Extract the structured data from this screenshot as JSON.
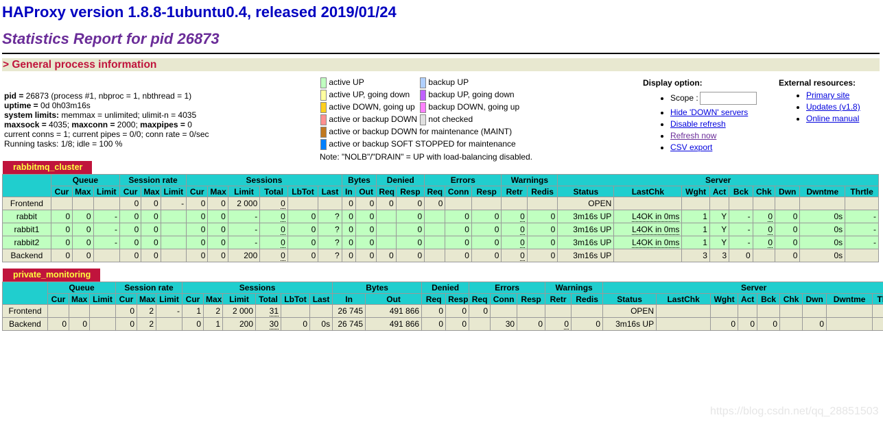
{
  "title": "HAProxy version 1.8.8-1ubuntu0.4, released 2019/01/24",
  "subtitle": "Statistics Report for pid 26873",
  "general_header": "> General process information",
  "process_info": [
    {
      "label": "pid = ",
      "value": "26873 (process #1, nbproc = 1, nbthread = 1)"
    },
    {
      "label": "uptime = ",
      "value": "0d 0h03m16s"
    },
    {
      "label": "system limits:",
      "value": " memmax = unlimited; ulimit-n = 4035"
    },
    {
      "label": "maxsock = ",
      "value": "4035; ",
      "label2": "maxconn = ",
      "value2": "2000; ",
      "label3": "maxpipes = ",
      "value3": "0"
    },
    {
      "label": "",
      "value": "current conns = 1; current pipes = 0/0; conn rate = 0/sec"
    },
    {
      "label": "",
      "value": "Running tasks: 1/8; idle = 100 %"
    }
  ],
  "legend": {
    "rows": [
      [
        {
          "color": "#c0ffc0",
          "text": "active UP"
        },
        {
          "color": "#b0d0ff",
          "text": "backup UP"
        }
      ],
      [
        {
          "color": "#ffffa0",
          "text": "active UP, going down"
        },
        {
          "color": "#c060ff",
          "text": "backup UP, going down"
        }
      ],
      [
        {
          "color": "#ffd020",
          "text": "active DOWN, going up"
        },
        {
          "color": "#ff80ff",
          "text": "backup DOWN, going up"
        }
      ],
      [
        {
          "color": "#ff9090",
          "text": "active or backup DOWN"
        },
        {
          "color": "#e0e0e0",
          "text": "not checked"
        }
      ],
      [
        {
          "color": "#c07820",
          "text": "active or backup DOWN for maintenance (MAINT)"
        }
      ],
      [
        {
          "color": "#0080ff",
          "text": "active or backup SOFT STOPPED for maintenance"
        }
      ]
    ],
    "note": "Note: \"NOLB\"/\"DRAIN\" = UP with load-balancing disabled."
  },
  "display": {
    "title": "Display option:",
    "scope_label": "Scope :",
    "links": [
      "Hide 'DOWN' servers",
      "Disable refresh",
      "Refresh now",
      "CSV export"
    ]
  },
  "external": {
    "title": "External resources:",
    "links": [
      "Primary site",
      "Updates (v1.8)",
      "Online manual"
    ]
  },
  "proxies": [
    {
      "name": "rabbitmq_cluster",
      "groups": [
        "Queue",
        "Session rate",
        "Sessions",
        "Bytes",
        "Denied",
        "Errors",
        "Warnings",
        "Server"
      ],
      "columns": [
        "Cur",
        "Max",
        "Limit",
        "Cur",
        "Max",
        "Limit",
        "Cur",
        "Max",
        "Limit",
        "Total",
        "LbTot",
        "Last",
        "In",
        "Out",
        "Req",
        "Resp",
        "Req",
        "Conn",
        "Resp",
        "Retr",
        "Redis",
        "Status",
        "LastChk",
        "Wght",
        "Act",
        "Bck",
        "Chk",
        "Dwn",
        "Dwntme",
        "Thrtle"
      ],
      "rows": [
        {
          "kind": "fe",
          "name": "Frontend",
          "cells": [
            "",
            "",
            "",
            "0",
            "0",
            "-",
            "0",
            "0",
            "2 000",
            "0",
            "",
            "",
            "0",
            "0",
            "0",
            "0",
            "0",
            "",
            "",
            "",
            "",
            "OPEN",
            "",
            "",
            "",
            "",
            "",
            "",
            "",
            ""
          ]
        },
        {
          "kind": "sv",
          "name": "rabbit",
          "cells": [
            "0",
            "0",
            "-",
            "0",
            "0",
            "",
            "0",
            "0",
            "-",
            "0",
            "0",
            "?",
            "0",
            "0",
            "",
            "0",
            "",
            "0",
            "0",
            "0",
            "0",
            "3m16s UP",
            "L4OK in 0ms",
            "1",
            "Y",
            "-",
            "0",
            "0",
            "0s",
            "-"
          ]
        },
        {
          "kind": "sv",
          "name": "rabbit1",
          "cells": [
            "0",
            "0",
            "-",
            "0",
            "0",
            "",
            "0",
            "0",
            "-",
            "0",
            "0",
            "?",
            "0",
            "0",
            "",
            "0",
            "",
            "0",
            "0",
            "0",
            "0",
            "3m16s UP",
            "L4OK in 0ms",
            "1",
            "Y",
            "-",
            "0",
            "0",
            "0s",
            "-"
          ]
        },
        {
          "kind": "sv",
          "name": "rabbit2",
          "cells": [
            "0",
            "0",
            "-",
            "0",
            "0",
            "",
            "0",
            "0",
            "-",
            "0",
            "0",
            "?",
            "0",
            "0",
            "",
            "0",
            "",
            "0",
            "0",
            "0",
            "0",
            "3m16s UP",
            "L4OK in 0ms",
            "1",
            "Y",
            "-",
            "0",
            "0",
            "0s",
            "-"
          ]
        },
        {
          "kind": "be",
          "name": "Backend",
          "cells": [
            "0",
            "0",
            "",
            "0",
            "0",
            "",
            "0",
            "0",
            "200",
            "0",
            "0",
            "?",
            "0",
            "0",
            "0",
            "0",
            "",
            "0",
            "0",
            "0",
            "0",
            "3m16s UP",
            "",
            "3",
            "3",
            "0",
            "",
            "0",
            "0s",
            ""
          ]
        }
      ]
    },
    {
      "name": "private_monitoring",
      "groups": [
        "Queue",
        "Session rate",
        "Sessions",
        "Bytes",
        "Denied",
        "Errors",
        "Warnings",
        "Server"
      ],
      "columns": [
        "Cur",
        "Max",
        "Limit",
        "Cur",
        "Max",
        "Limit",
        "Cur",
        "Max",
        "Limit",
        "Total",
        "LbTot",
        "Last",
        "In",
        "Out",
        "Req",
        "Resp",
        "Req",
        "Conn",
        "Resp",
        "Retr",
        "Redis",
        "Status",
        "LastChk",
        "Wght",
        "Act",
        "Bck",
        "Chk",
        "Dwn",
        "Dwntme",
        "Thrtle"
      ],
      "rows": [
        {
          "kind": "fe",
          "name": "Frontend",
          "cells": [
            "",
            "",
            "",
            "0",
            "2",
            "-",
            "1",
            "2",
            "2 000",
            "31",
            "",
            "",
            "26 745",
            "491 866",
            "0",
            "0",
            "0",
            "",
            "",
            "",
            "",
            "OPEN",
            "",
            "",
            "",
            "",
            "",
            "",
            "",
            ""
          ]
        },
        {
          "kind": "be",
          "name": "Backend",
          "cells": [
            "0",
            "0",
            "",
            "0",
            "2",
            "",
            "0",
            "1",
            "200",
            "30",
            "0",
            "0s",
            "26 745",
            "491 866",
            "0",
            "0",
            "",
            "30",
            "0",
            "0",
            "0",
            "3m16s UP",
            "",
            "0",
            "0",
            "0",
            "",
            "0",
            "",
            ""
          ]
        }
      ]
    }
  ],
  "watermark": "https://blog.csdn.net/qq_28851503"
}
